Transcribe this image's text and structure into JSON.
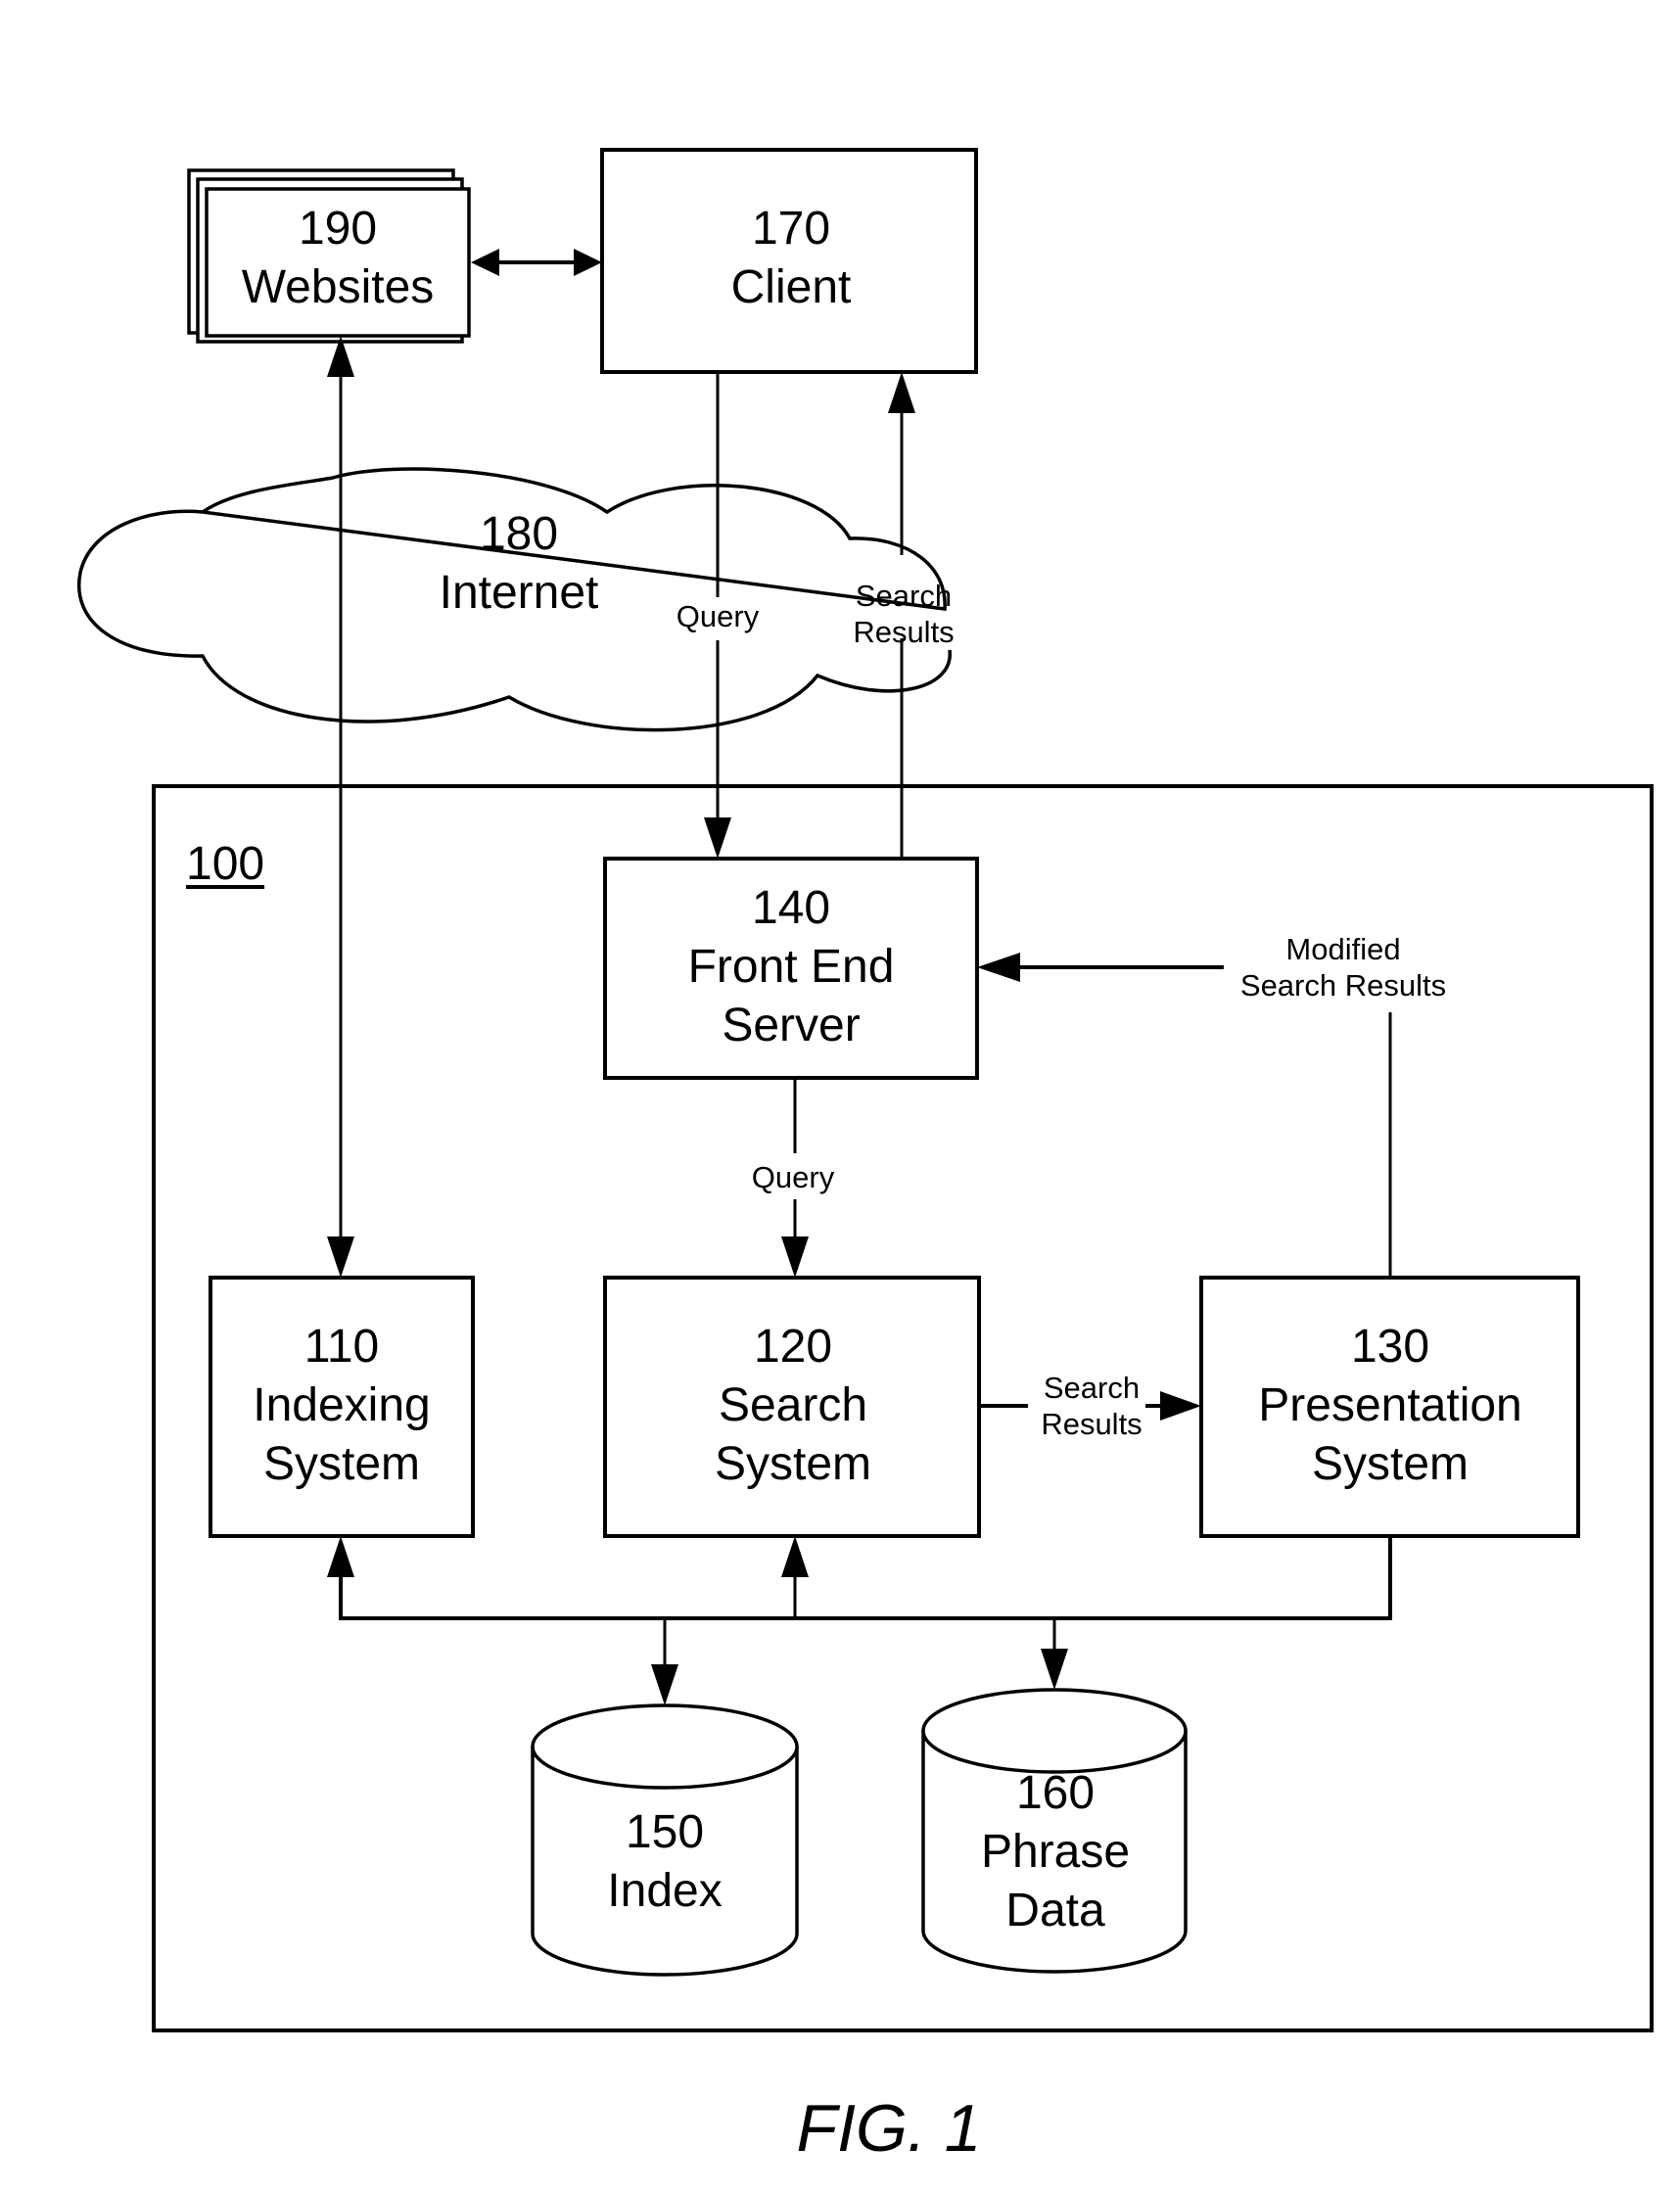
{
  "figure": {
    "caption": "FIG. 1",
    "system_ref": "100"
  },
  "nodes": {
    "websites": {
      "ref": "190",
      "label": "Websites",
      "shape": "stacked-documents"
    },
    "client": {
      "ref": "170",
      "label": "Client",
      "shape": "box"
    },
    "internet": {
      "ref": "180",
      "label": "Internet",
      "shape": "cloud"
    },
    "front_end": {
      "ref": "140",
      "label_line1": "Front End",
      "label_line2": "Server",
      "shape": "box"
    },
    "indexing": {
      "ref": "110",
      "label_line1": "Indexing",
      "label_line2": "System",
      "shape": "box"
    },
    "search": {
      "ref": "120",
      "label_line1": "Search",
      "label_line2": "System",
      "shape": "box"
    },
    "presentation": {
      "ref": "130",
      "label_line1": "Presentation",
      "label_line2": "System",
      "shape": "box"
    },
    "index": {
      "ref": "150",
      "label": "Index",
      "shape": "cylinder"
    },
    "phrase_data": {
      "ref": "160",
      "label_line1": "Phrase",
      "label_line2": "Data",
      "shape": "cylinder"
    }
  },
  "edges": {
    "client_to_front_end": {
      "label": "Query"
    },
    "front_end_to_client": {
      "label_line1": "Search",
      "label_line2": "Results"
    },
    "front_end_to_search": {
      "label": "Query"
    },
    "search_to_presentation": {
      "label_line1": "Search",
      "label_line2": "Results"
    },
    "presentation_to_front_end": {
      "label_line1": "Modified",
      "label_line2": "Search Results"
    },
    "websites_client": {
      "label": "",
      "direction": "bidirectional"
    },
    "websites_indexing": {
      "label": "",
      "direction": "bidirectional"
    },
    "bus_to_index": {
      "label": ""
    },
    "bus_to_phrase_data": {
      "label": ""
    }
  }
}
